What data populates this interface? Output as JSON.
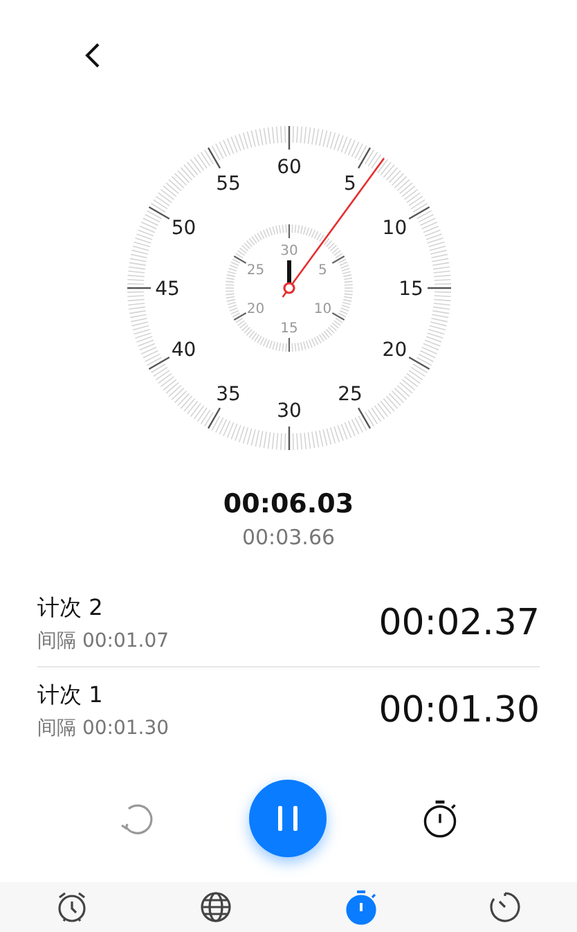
{
  "dial": {
    "outer_labels": [
      "60",
      "5",
      "10",
      "15",
      "20",
      "25",
      "30",
      "35",
      "40",
      "45",
      "50",
      "55"
    ],
    "inner_labels": [
      "30",
      "5",
      "10",
      "15",
      "20",
      "25"
    ]
  },
  "total_time": "00:06.03",
  "lap_time": "00:03.66",
  "laps": [
    {
      "name": "计次 2",
      "interval": "间隔 00:01.07",
      "time": "00:02.37"
    },
    {
      "name": "计次 1",
      "interval": "间隔 00:01.30",
      "time": "00:01.30"
    }
  ],
  "tabs": [
    {
      "kind": "alarm",
      "selected": false
    },
    {
      "kind": "world",
      "selected": false
    },
    {
      "kind": "stopwatch",
      "selected": true
    },
    {
      "kind": "timer",
      "selected": false
    }
  ]
}
